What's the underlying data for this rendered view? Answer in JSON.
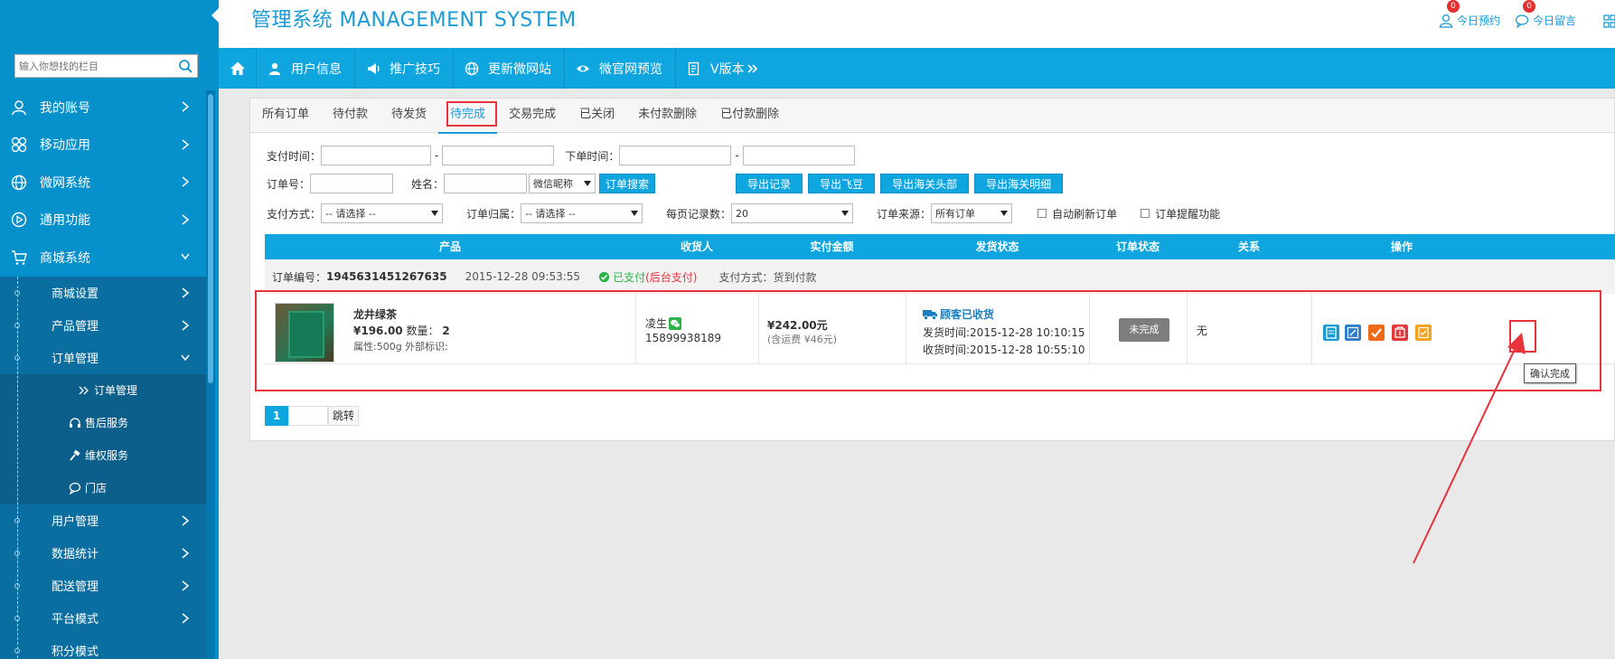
{
  "header": {
    "title": "管理系统 MANAGEMENT SYSTEM",
    "links": [
      {
        "label": "今日预约",
        "badge": "0"
      },
      {
        "label": "今日留言",
        "badge": "0"
      }
    ]
  },
  "sidebar": {
    "search_placeholder": "输入你想找的栏目",
    "items": [
      {
        "label": "我的账号"
      },
      {
        "label": "移动应用"
      },
      {
        "label": "微网系统"
      },
      {
        "label": "通用功能"
      },
      {
        "label": "商城系统"
      }
    ],
    "sub_items": [
      {
        "label": "商城设置"
      },
      {
        "label": "产品管理"
      },
      {
        "label": "订单管理"
      }
    ],
    "order_sub_items": [
      {
        "label": "订单管理"
      },
      {
        "label": "售后服务"
      },
      {
        "label": "维权服务"
      },
      {
        "label": "门店"
      }
    ],
    "sub_items_more": [
      {
        "label": "用户管理"
      },
      {
        "label": "数据统计"
      },
      {
        "label": "配送管理"
      },
      {
        "label": "平台模式"
      },
      {
        "label": "积分模式"
      }
    ]
  },
  "topnav": {
    "items": [
      {
        "label": "用户信息"
      },
      {
        "label": "推广技巧"
      },
      {
        "label": "更新微网站"
      },
      {
        "label": "微官网预览"
      },
      {
        "label": "V版本"
      }
    ]
  },
  "tabs": [
    {
      "label": "所有订单"
    },
    {
      "label": "待付款"
    },
    {
      "label": "待发货"
    },
    {
      "label": "待完成"
    },
    {
      "label": "交易完成"
    },
    {
      "label": "已关闭"
    },
    {
      "label": "未付款删除"
    },
    {
      "label": "已付款删除"
    }
  ],
  "filters": {
    "pay_time_label": "支付时间：",
    "order_time_label": "下单时间：",
    "dash": "-",
    "order_no_label": "订单号：",
    "name_label": "姓名：",
    "name_type": "微信昵称",
    "search_btn": "订单搜索",
    "export_buttons": [
      "导出记录",
      "导出飞豆",
      "导出海关头部",
      "导出海关明细"
    ],
    "pay_method_label": "支付方式：",
    "pay_method_value": "-- 请选择 --",
    "order_attr_label": "订单归属：",
    "order_attr_value": "-- 请选择 --",
    "per_page_label": "每页记录数：",
    "per_page_value": "20",
    "source_label": "订单来源：",
    "source_value": "所有订单",
    "auto_refresh": "自动刷新订单",
    "reminder": "订单提醒功能"
  },
  "table": {
    "headers": [
      "产品",
      "收货人",
      "实付金额",
      "发货状态",
      "订单状态",
      "关系",
      "操作"
    ]
  },
  "order": {
    "no_label": "订单编号：",
    "no": "1945631451267635",
    "time": "2015-12-28 09:53:55",
    "paid_status": "已支付",
    "paid_note": "(后台支付)",
    "pay_method": "支付方式：货到付款",
    "product_name": "龙井绿茶",
    "price": "¥196.00",
    "qty_label": "数量：",
    "qty": "2",
    "attr": "属性:500g 外部标识:",
    "consignee": "凌生",
    "phone": "15899938189",
    "amount": "¥242.00元",
    "shipping_fee": "(含运费 ¥46元)",
    "ship_status": "顾客已收货",
    "ship_time": "发货时间:2015-12-28 10:10:15",
    "receive_time": "收货时间:2015-12-28 10:55:10",
    "order_status": "未完成",
    "relation": "无",
    "tooltip": "确认完成"
  },
  "pager": {
    "current": "1",
    "jump": "跳转"
  },
  "colors": {
    "primary": "#0fa6e0",
    "sidebar": "#0690cc",
    "highlight": "#e8323c"
  }
}
